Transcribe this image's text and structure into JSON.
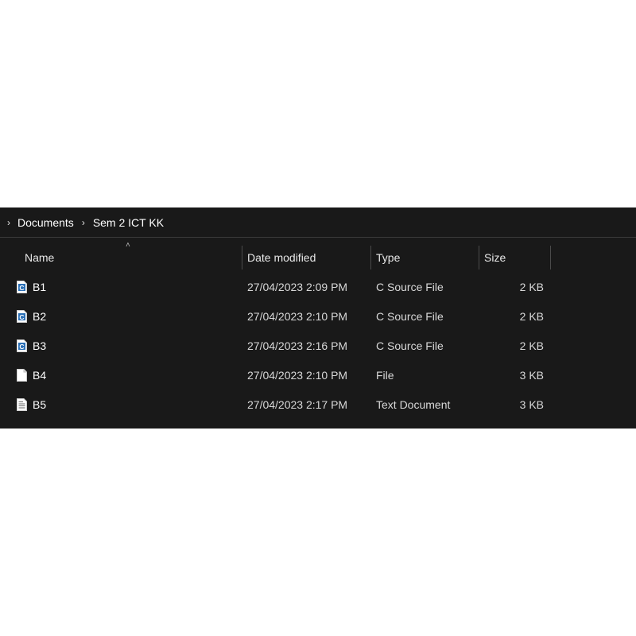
{
  "breadcrumb": {
    "items": [
      "Documents",
      "Sem 2 ICT KK"
    ]
  },
  "columns": {
    "name": "Name",
    "date_modified": "Date modified",
    "type": "Type",
    "size": "Size"
  },
  "files": [
    {
      "name": "B1",
      "date": "27/04/2023 2:09 PM",
      "type": "C Source File",
      "size": "2 KB",
      "icon": "c-source-file-icon"
    },
    {
      "name": "B2",
      "date": "27/04/2023 2:10 PM",
      "type": "C Source File",
      "size": "2 KB",
      "icon": "c-source-file-icon"
    },
    {
      "name": "B3",
      "date": "27/04/2023 2:16 PM",
      "type": "C Source File",
      "size": "2 KB",
      "icon": "c-source-file-icon"
    },
    {
      "name": "B4",
      "date": "27/04/2023 2:10 PM",
      "type": "File",
      "size": "3 KB",
      "icon": "blank-file-icon"
    },
    {
      "name": "B5",
      "date": "27/04/2023 2:17 PM",
      "type": "Text Document",
      "size": "3 KB",
      "icon": "text-document-icon"
    }
  ],
  "colors": {
    "background": "#191919",
    "text": "#ffffff",
    "c_icon_accent": "#2a6fb6"
  }
}
